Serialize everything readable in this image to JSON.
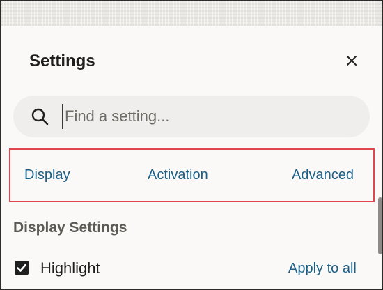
{
  "dialog": {
    "title": "Settings",
    "close_icon": "close-icon"
  },
  "search": {
    "icon": "search-icon",
    "placeholder": "Find a setting...",
    "value": ""
  },
  "tabs": [
    {
      "label": "Display"
    },
    {
      "label": "Activation"
    },
    {
      "label": "Advanced"
    }
  ],
  "highlight_box_color": "#e0474c",
  "link_color": "#1a5f86",
  "section": {
    "title": "Display Settings",
    "rows": [
      {
        "label": "Highlight",
        "checked": true,
        "action": "Apply to all"
      }
    ]
  }
}
